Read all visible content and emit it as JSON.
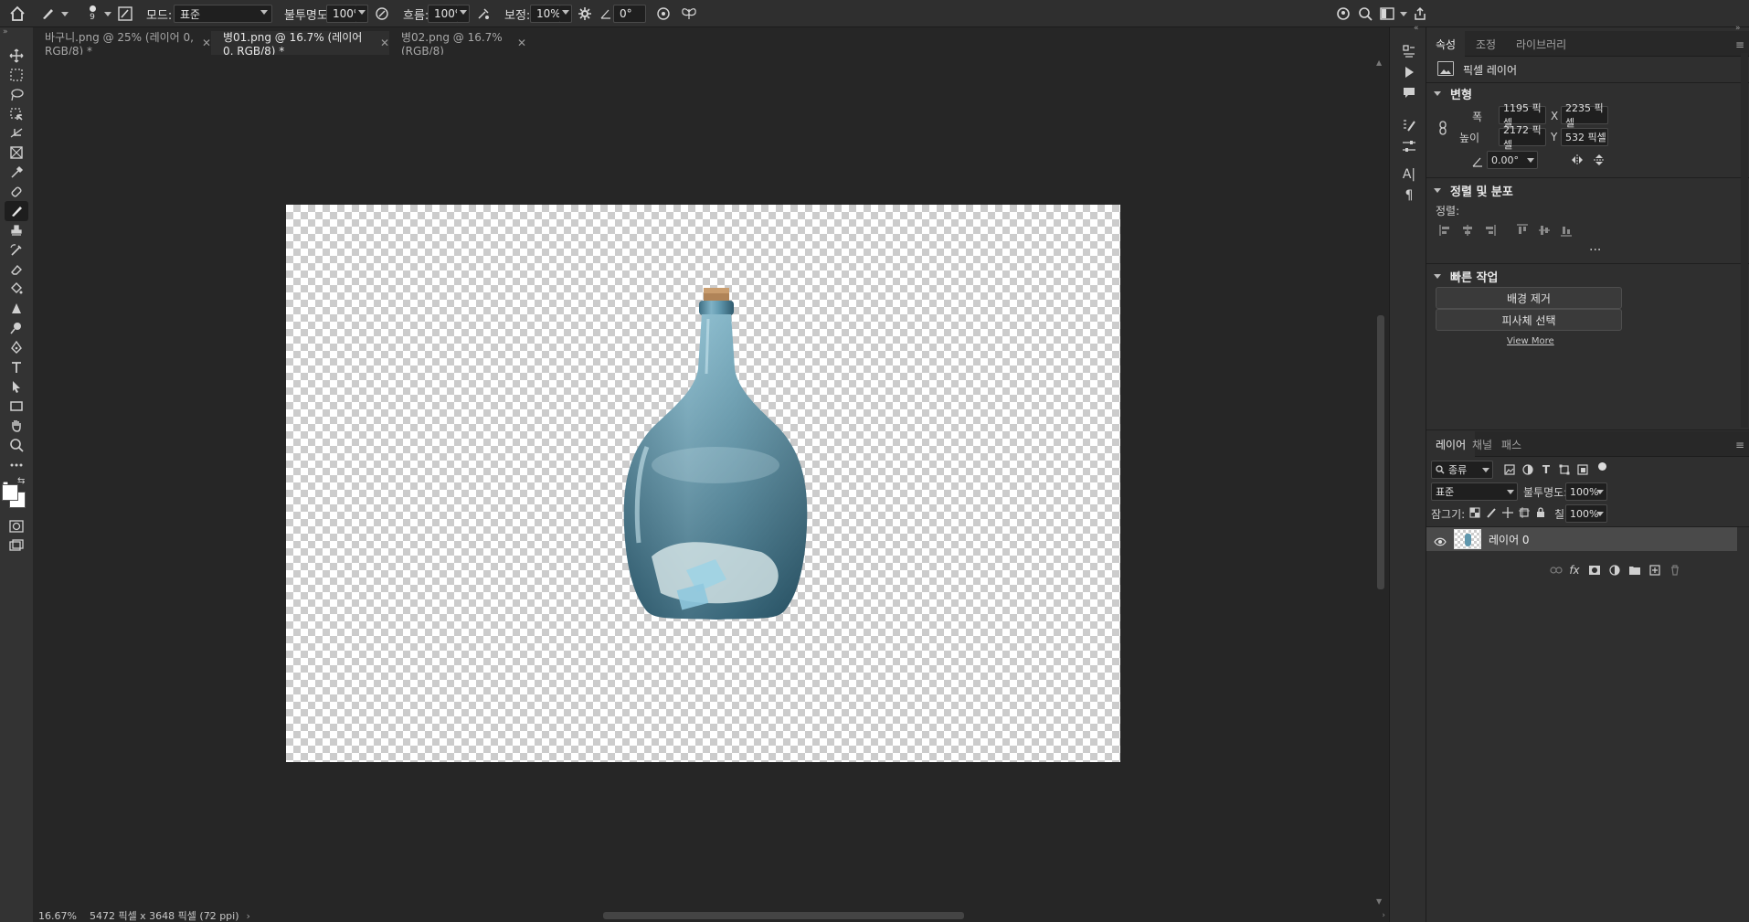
{
  "option_bar": {
    "mode_label": "모드:",
    "mode_value": "표준",
    "opacity_label": "불투명도:",
    "opacity_value": "100%",
    "flow_label": "흐름:",
    "flow_value": "100%",
    "smoothing_label": "보정:",
    "smoothing_value": "10%",
    "angle_value": "0°",
    "brush_size": "9"
  },
  "tabs": [
    {
      "label": "바구니.png @ 25% (레이어 0, RGB/8) *",
      "active": false
    },
    {
      "label": "병01.png @ 16.7% (레이어 0, RGB/8) *",
      "active": true
    },
    {
      "label": "병02.png @ 16.7% (RGB/8)",
      "active": false
    }
  ],
  "status": {
    "zoom": "16.67%",
    "doc_info": "5472 픽셀 x 3648 픽셀 (72 ppi)"
  },
  "properties": {
    "tabs": [
      "속성",
      "조정",
      "라이브러리"
    ],
    "layer_type": "픽셀 레이어",
    "transform": {
      "title": "변형",
      "width_label": "폭",
      "width": "1195 픽셀",
      "height_label": "높이",
      "height": "2172 픽셀",
      "x_label": "X",
      "x": "2235 픽셀",
      "y_label": "Y",
      "y": "532 픽셀",
      "angle": "0.00°"
    },
    "align": {
      "title": "정렬 및 분포",
      "label": "정렬:"
    },
    "quick_actions": {
      "title": "빠른 작업",
      "remove_bg": "배경 제거",
      "select_subject": "피사체 선택",
      "view_more": "View More"
    }
  },
  "layers": {
    "tabs": [
      "레이어",
      "채널",
      "패스"
    ],
    "filter_label": "종류",
    "blend_mode": "표준",
    "opacity_label": "불투명도:",
    "opacity": "100%",
    "lock_label": "잠그기:",
    "fill_label": "칠:",
    "fill": "100%",
    "items": [
      {
        "name": "레이어 0",
        "visible": true
      }
    ]
  },
  "colors": {
    "foreground": "#ffffff",
    "background": "#ffffff",
    "bottle": "#5f97ad"
  }
}
